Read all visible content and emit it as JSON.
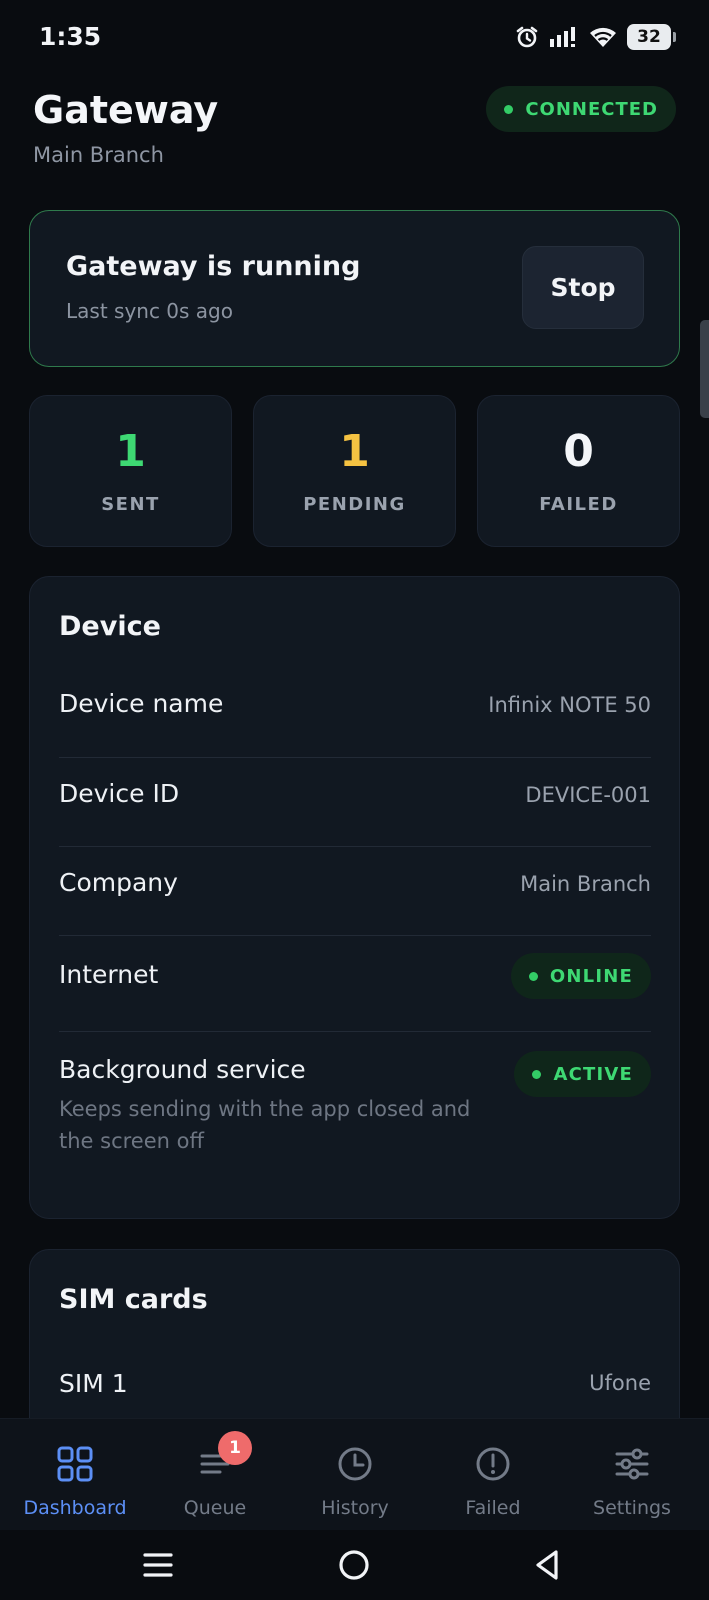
{
  "status_bar": {
    "time": "1:35",
    "battery": "32"
  },
  "header": {
    "title": "Gateway",
    "subtitle": "Main Branch",
    "connection_status": "CONNECTED"
  },
  "running_card": {
    "title": "Gateway is running",
    "last_sync": "Last sync 0s ago",
    "stop_label": "Stop"
  },
  "stats": [
    {
      "value": "1",
      "label": "SENT",
      "color": "#3ed873"
    },
    {
      "value": "1",
      "label": "PENDING",
      "color": "#f5c242"
    },
    {
      "value": "0",
      "label": "FAILED",
      "color": "#f4f6f9"
    }
  ],
  "device": {
    "title": "Device",
    "device_name_label": "Device name",
    "device_name_value": "Infinix NOTE 50",
    "device_id_label": "Device ID",
    "device_id_value": "DEVICE-001",
    "company_label": "Company",
    "company_value": "Main Branch",
    "internet_label": "Internet",
    "internet_status": "ONLINE",
    "service_label": "Background service",
    "service_status": "ACTIVE",
    "service_desc": "Keeps sending with the app closed and the screen off"
  },
  "sim": {
    "title": "SIM cards",
    "sim1_label": "SIM 1",
    "sim1_value": "Ufone"
  },
  "nav": {
    "dashboard": "Dashboard",
    "queue": "Queue",
    "queue_badge": "1",
    "history": "History",
    "failed": "Failed",
    "settings": "Settings"
  },
  "colors": {
    "accent": "#5c8ff5",
    "success": "#3ed873",
    "warning": "#f5c242",
    "badge": "#ef6b6b"
  }
}
